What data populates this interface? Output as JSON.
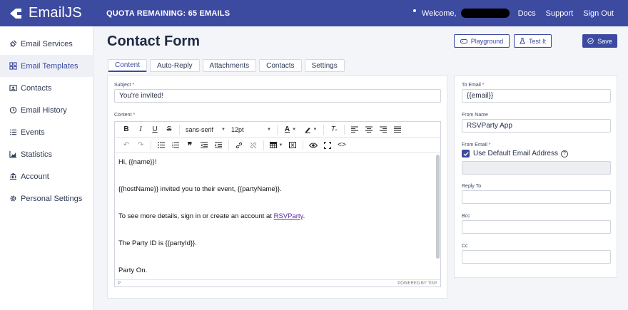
{
  "brand": {
    "name": "EmailJS",
    "accent": "#3c4aa0"
  },
  "topbar": {
    "quota": "QUOTA REMAINING: 65 EMAILS",
    "welcome": "Welcome,",
    "links": [
      "Docs",
      "Support",
      "Sign Out"
    ]
  },
  "sidebar": {
    "items": [
      {
        "label": "Email Services",
        "icon": "plug-icon"
      },
      {
        "label": "Email Templates",
        "icon": "templates-icon",
        "active": true
      },
      {
        "label": "Contacts",
        "icon": "contacts-icon"
      },
      {
        "label": "Email History",
        "icon": "history-icon"
      },
      {
        "label": "Events",
        "icon": "list-icon"
      },
      {
        "label": "Statistics",
        "icon": "chart-icon"
      },
      {
        "label": "Account",
        "icon": "bank-icon"
      },
      {
        "label": "Personal Settings",
        "icon": "gear-icon"
      }
    ]
  },
  "header": {
    "title": "Contact Form",
    "playground": "Playground",
    "test_it": "Test It",
    "save": "Save"
  },
  "tabs": [
    "Content",
    "Auto-Reply",
    "Attachments",
    "Contacts",
    "Settings"
  ],
  "form": {
    "subject_label": "Subject",
    "subject_value": "You're invited!",
    "content_label": "Content",
    "required_mark": "*"
  },
  "editor": {
    "font_family": "sans-serif",
    "font_size": "12pt",
    "body": {
      "line1": "Hi, {{name}}!",
      "line2": "{{hostName}} invited you to their event, {{partyName}}.",
      "line3_prefix": "To see more details, sign in or create an account at ",
      "line3_link": "RSVParty",
      "line3_suffix": ".",
      "line4": "The Party ID is {{partyId}}.",
      "line5": "Party On."
    },
    "path": "P",
    "powered_by": "POWERED BY TINY"
  },
  "side_form": {
    "to_email_label": "To Email",
    "to_email_value": "{{email}}",
    "from_name_label": "From Name",
    "from_name_value": "RSVParty App",
    "from_email_label": "From Email",
    "use_default_label": "Use Default Email Address",
    "use_default_checked": true,
    "reply_to_label": "Reply To",
    "bcc_label": "Bcc",
    "cc_label": "Cc"
  }
}
